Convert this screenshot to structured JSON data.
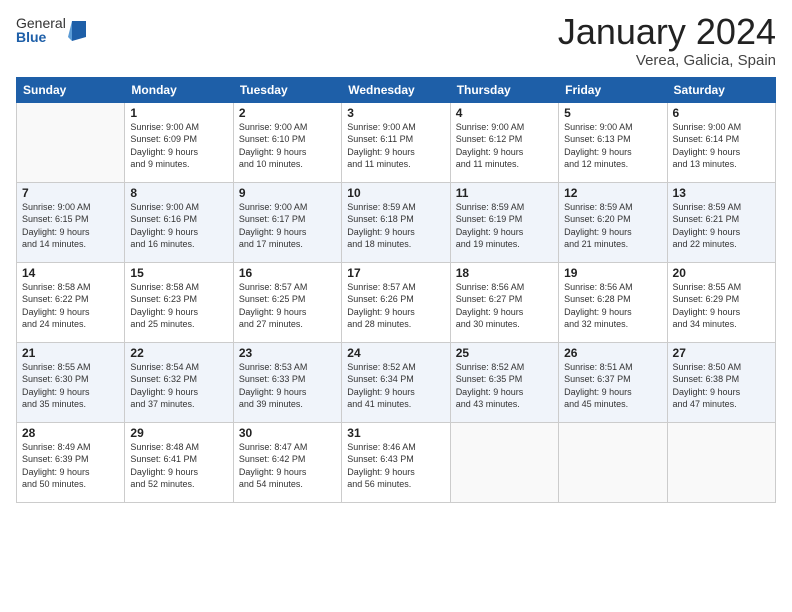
{
  "logo": {
    "general": "General",
    "blue": "Blue"
  },
  "title": "January 2024",
  "location": "Verea, Galicia, Spain",
  "weekdays": [
    "Sunday",
    "Monday",
    "Tuesday",
    "Wednesday",
    "Thursday",
    "Friday",
    "Saturday"
  ],
  "weeks": [
    [
      {
        "day": "",
        "info": ""
      },
      {
        "day": "1",
        "info": "Sunrise: 9:00 AM\nSunset: 6:09 PM\nDaylight: 9 hours\nand 9 minutes."
      },
      {
        "day": "2",
        "info": "Sunrise: 9:00 AM\nSunset: 6:10 PM\nDaylight: 9 hours\nand 10 minutes."
      },
      {
        "day": "3",
        "info": "Sunrise: 9:00 AM\nSunset: 6:11 PM\nDaylight: 9 hours\nand 11 minutes."
      },
      {
        "day": "4",
        "info": "Sunrise: 9:00 AM\nSunset: 6:12 PM\nDaylight: 9 hours\nand 11 minutes."
      },
      {
        "day": "5",
        "info": "Sunrise: 9:00 AM\nSunset: 6:13 PM\nDaylight: 9 hours\nand 12 minutes."
      },
      {
        "day": "6",
        "info": "Sunrise: 9:00 AM\nSunset: 6:14 PM\nDaylight: 9 hours\nand 13 minutes."
      }
    ],
    [
      {
        "day": "7",
        "info": "Sunrise: 9:00 AM\nSunset: 6:15 PM\nDaylight: 9 hours\nand 14 minutes."
      },
      {
        "day": "8",
        "info": "Sunrise: 9:00 AM\nSunset: 6:16 PM\nDaylight: 9 hours\nand 16 minutes."
      },
      {
        "day": "9",
        "info": "Sunrise: 9:00 AM\nSunset: 6:17 PM\nDaylight: 9 hours\nand 17 minutes."
      },
      {
        "day": "10",
        "info": "Sunrise: 8:59 AM\nSunset: 6:18 PM\nDaylight: 9 hours\nand 18 minutes."
      },
      {
        "day": "11",
        "info": "Sunrise: 8:59 AM\nSunset: 6:19 PM\nDaylight: 9 hours\nand 19 minutes."
      },
      {
        "day": "12",
        "info": "Sunrise: 8:59 AM\nSunset: 6:20 PM\nDaylight: 9 hours\nand 21 minutes."
      },
      {
        "day": "13",
        "info": "Sunrise: 8:59 AM\nSunset: 6:21 PM\nDaylight: 9 hours\nand 22 minutes."
      }
    ],
    [
      {
        "day": "14",
        "info": "Sunrise: 8:58 AM\nSunset: 6:22 PM\nDaylight: 9 hours\nand 24 minutes."
      },
      {
        "day": "15",
        "info": "Sunrise: 8:58 AM\nSunset: 6:23 PM\nDaylight: 9 hours\nand 25 minutes."
      },
      {
        "day": "16",
        "info": "Sunrise: 8:57 AM\nSunset: 6:25 PM\nDaylight: 9 hours\nand 27 minutes."
      },
      {
        "day": "17",
        "info": "Sunrise: 8:57 AM\nSunset: 6:26 PM\nDaylight: 9 hours\nand 28 minutes."
      },
      {
        "day": "18",
        "info": "Sunrise: 8:56 AM\nSunset: 6:27 PM\nDaylight: 9 hours\nand 30 minutes."
      },
      {
        "day": "19",
        "info": "Sunrise: 8:56 AM\nSunset: 6:28 PM\nDaylight: 9 hours\nand 32 minutes."
      },
      {
        "day": "20",
        "info": "Sunrise: 8:55 AM\nSunset: 6:29 PM\nDaylight: 9 hours\nand 34 minutes."
      }
    ],
    [
      {
        "day": "21",
        "info": "Sunrise: 8:55 AM\nSunset: 6:30 PM\nDaylight: 9 hours\nand 35 minutes."
      },
      {
        "day": "22",
        "info": "Sunrise: 8:54 AM\nSunset: 6:32 PM\nDaylight: 9 hours\nand 37 minutes."
      },
      {
        "day": "23",
        "info": "Sunrise: 8:53 AM\nSunset: 6:33 PM\nDaylight: 9 hours\nand 39 minutes."
      },
      {
        "day": "24",
        "info": "Sunrise: 8:52 AM\nSunset: 6:34 PM\nDaylight: 9 hours\nand 41 minutes."
      },
      {
        "day": "25",
        "info": "Sunrise: 8:52 AM\nSunset: 6:35 PM\nDaylight: 9 hours\nand 43 minutes."
      },
      {
        "day": "26",
        "info": "Sunrise: 8:51 AM\nSunset: 6:37 PM\nDaylight: 9 hours\nand 45 minutes."
      },
      {
        "day": "27",
        "info": "Sunrise: 8:50 AM\nSunset: 6:38 PM\nDaylight: 9 hours\nand 47 minutes."
      }
    ],
    [
      {
        "day": "28",
        "info": "Sunrise: 8:49 AM\nSunset: 6:39 PM\nDaylight: 9 hours\nand 50 minutes."
      },
      {
        "day": "29",
        "info": "Sunrise: 8:48 AM\nSunset: 6:41 PM\nDaylight: 9 hours\nand 52 minutes."
      },
      {
        "day": "30",
        "info": "Sunrise: 8:47 AM\nSunset: 6:42 PM\nDaylight: 9 hours\nand 54 minutes."
      },
      {
        "day": "31",
        "info": "Sunrise: 8:46 AM\nSunset: 6:43 PM\nDaylight: 9 hours\nand 56 minutes."
      },
      {
        "day": "",
        "info": ""
      },
      {
        "day": "",
        "info": ""
      },
      {
        "day": "",
        "info": ""
      }
    ]
  ]
}
